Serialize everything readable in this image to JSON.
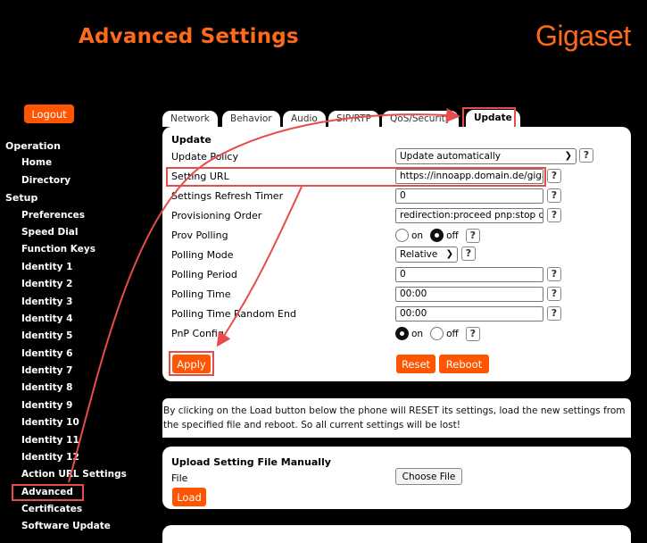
{
  "header": {
    "title": "Advanced Settings",
    "logo": "Gigaset"
  },
  "logout_label": "Logout",
  "sidebar": {
    "sections": [
      {
        "label": "Operation",
        "items": [
          "Home",
          "Directory"
        ]
      },
      {
        "label": "Setup",
        "items": [
          "Preferences",
          "Speed Dial",
          "Function Keys",
          "Identity 1",
          "Identity 2",
          "Identity 3",
          "Identity 4",
          "Identity 5",
          "Identity 6",
          "Identity 7",
          "Identity 8",
          "Identity 9",
          "Identity 10",
          "Identity 11",
          "Identity 12",
          "Action URL Settings",
          "Advanced",
          "Certificates",
          "Software Update"
        ]
      }
    ],
    "active_item": "Advanced"
  },
  "tabs": [
    "Network",
    "Behavior",
    "Audio",
    "SIP/RTP",
    "QoS/Security",
    "Update"
  ],
  "active_tab": "Update",
  "update_panel": {
    "heading": "Update",
    "rows": {
      "update_policy": {
        "label": "Update Policy",
        "value": "Update automatically"
      },
      "setting_url": {
        "label": "Setting URL",
        "value": "https://innoapp.domain.de/giga"
      },
      "refresh_timer": {
        "label": "Settings Refresh Timer",
        "value": "0"
      },
      "prov_order": {
        "label": "Provisioning Order",
        "value": "redirection:proceed pnp:stop dl"
      },
      "prov_polling": {
        "label": "Prov Polling",
        "on": "on",
        "off": "off",
        "selected": "off"
      },
      "polling_mode": {
        "label": "Polling Mode",
        "value": "Relative"
      },
      "polling_period": {
        "label": "Polling Period",
        "value": "0"
      },
      "polling_time": {
        "label": "Polling Time",
        "value": "00:00"
      },
      "polling_random_end": {
        "label": "Polling Time Random End",
        "value": "00:00"
      },
      "pnp_config": {
        "label": "PnP Config",
        "on": "on",
        "off": "off",
        "selected": "on"
      }
    },
    "help_glyph": "?",
    "apply_label": "Apply",
    "reset_label": "Reset",
    "reboot_label": "Reboot"
  },
  "info_text": "By clicking on the Load button below the phone will RESET its settings, load the new settings from the specified file and reboot. So all current settings will be lost!",
  "upload_panel": {
    "heading": "Upload Setting File Manually",
    "file_label": "File",
    "choose_label": "Choose File",
    "load_label": "Load"
  },
  "colors": {
    "accent": "#ff5500",
    "brand": "#ff6a1a",
    "highlight": "#e74c4c",
    "background": "#000000"
  }
}
